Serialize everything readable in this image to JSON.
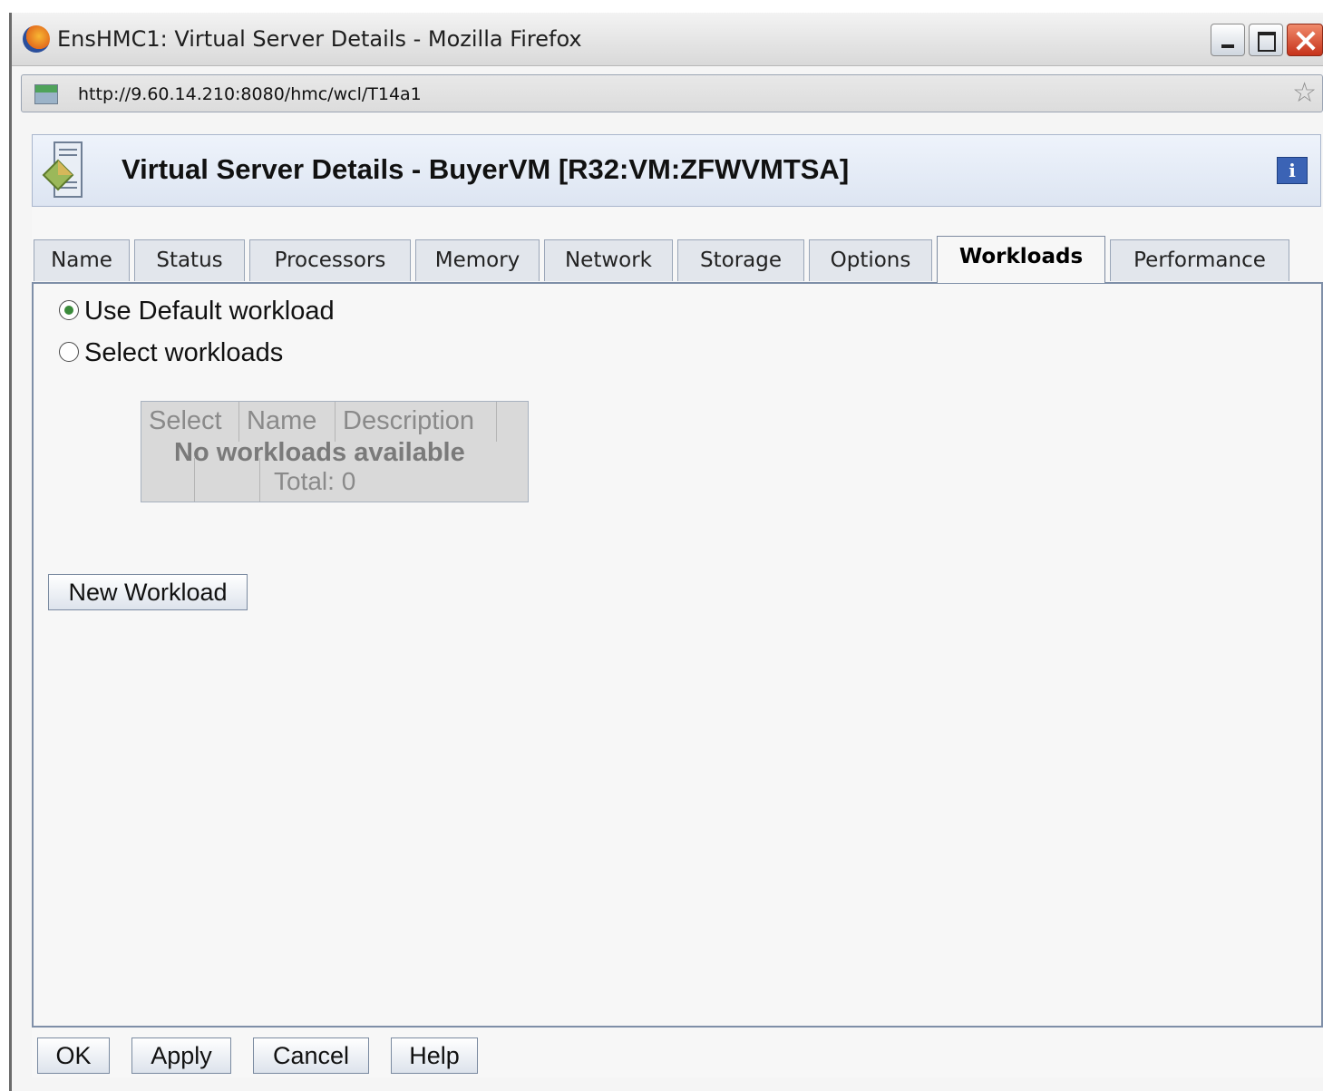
{
  "browser": {
    "window_title": "EnsHMC1: Virtual Server Details - Mozilla Firefox",
    "url": "http://9.60.14.210:8080/hmc/wcl/T14a1"
  },
  "dialog": {
    "title": "Virtual Server Details - BuyerVM [R32:VM:ZFWVMTSA]",
    "info_icon_glyph": "i",
    "tabs": [
      {
        "label": "Name"
      },
      {
        "label": "Status"
      },
      {
        "label": "Processors"
      },
      {
        "label": "Memory"
      },
      {
        "label": "Network"
      },
      {
        "label": "Storage"
      },
      {
        "label": "Options"
      },
      {
        "label": "Workloads",
        "active": true
      },
      {
        "label": "Performance"
      }
    ],
    "workloads": {
      "options": [
        {
          "label": "Use Default workload",
          "checked": true
        },
        {
          "label": "Select workloads",
          "checked": false
        }
      ],
      "table": {
        "columns": [
          "Select",
          "Name",
          "Description"
        ],
        "empty_message": "No workloads available",
        "total": "Total: 0"
      },
      "new_workload_label": "New Workload"
    },
    "footer": {
      "ok": "OK",
      "apply": "Apply",
      "cancel": "Cancel",
      "help": "Help"
    }
  },
  "colors": {
    "header_band": "#dde5f2",
    "tab_border": "#9aa6b8",
    "radio_checked": "#3a8a3a",
    "info_icon": "#3b63b5"
  }
}
